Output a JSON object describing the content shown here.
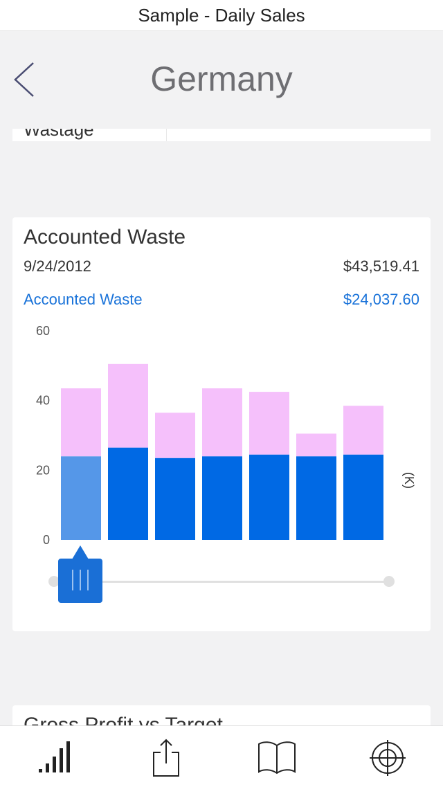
{
  "status_bar": {
    "app_title": "Sample - Daily Sales"
  },
  "nav": {
    "title": "Germany",
    "back_icon": "chevron-left-icon"
  },
  "previous_row": {
    "label": "Wastage"
  },
  "card": {
    "title": "Accounted Waste",
    "date": "9/24/2012",
    "total": "$43,519.41",
    "series_label": "Accounted Waste",
    "series_value": "$24,037.60",
    "selected_index": 0
  },
  "chart_data": {
    "type": "bar",
    "stacked": true,
    "categories": [
      "",
      "",
      "",
      "",
      "",
      "",
      ""
    ],
    "series": [
      {
        "name": "Accounted Waste",
        "values": [
          24,
          26.5,
          23.5,
          24,
          24.5,
          24,
          24.5
        ],
        "color": "#0069e4"
      },
      {
        "values": [
          19.5,
          24,
          13,
          19.5,
          18,
          6.5,
          14
        ],
        "color": "#f5c0fb"
      }
    ],
    "yticks": [
      "60",
      "40",
      "20",
      "0"
    ],
    "ylim": [
      0,
      60
    ],
    "unit": "(K)",
    "grid": false
  },
  "next_card": {
    "title": "Gross Profit vs Target"
  },
  "tab_bar": {
    "items": [
      {
        "icon": "signal-bars-icon"
      },
      {
        "icon": "share-icon"
      },
      {
        "icon": "book-icon"
      },
      {
        "icon": "target-icon"
      }
    ]
  },
  "colors": {
    "accent": "#1a73d9",
    "bar_primary": "#0069e4",
    "bar_selected": "#5597e8",
    "bar_secondary": "#f5c0fb",
    "background": "#f2f2f3"
  }
}
